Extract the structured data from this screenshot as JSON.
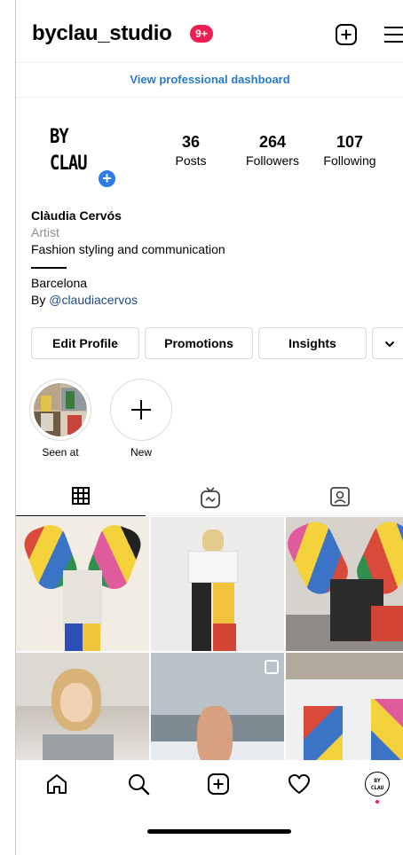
{
  "header": {
    "username": "byclau_studio",
    "notification_badge": "9+",
    "add_icon": "plus-square-icon",
    "menu_icon": "hamburger-menu-icon"
  },
  "pro_dashboard": {
    "label": "View professional dashboard"
  },
  "profile": {
    "avatar_text": {
      "line1": "BY",
      "line2": "CLAU"
    },
    "avatar_add_icon": "plus-circle-icon",
    "stats": {
      "posts": {
        "count": "36",
        "label": "Posts"
      },
      "followers": {
        "count": "264",
        "label": "Followers"
      },
      "following": {
        "count": "107",
        "label": "Following"
      }
    },
    "bio": {
      "name": "Clàudia Cervós",
      "category": "Artist",
      "line1": "Fashion styling and communication",
      "location": "Barcelona",
      "by_prefix": "By ",
      "mention": "@claudiacervos"
    }
  },
  "actions": {
    "edit_profile": "Edit Profile",
    "promotions": "Promotions",
    "insights": "Insights",
    "more_icon": "chevron-down-icon"
  },
  "highlights": [
    {
      "label": "Seen at"
    },
    {
      "label": "New"
    }
  ],
  "tabs": [
    {
      "icon": "grid-icon",
      "active": true
    },
    {
      "icon": "igtv-icon",
      "active": false
    },
    {
      "icon": "tagged-icon",
      "active": false
    }
  ],
  "bottom_nav": [
    {
      "icon": "home-icon"
    },
    {
      "icon": "search-icon"
    },
    {
      "icon": "new-post-icon"
    },
    {
      "icon": "heart-icon"
    },
    {
      "icon": "profile-avatar-icon",
      "label_line1": "BY",
      "label_line2": "CLAU"
    }
  ],
  "colors": {
    "accent_blue": "#2a79cf",
    "badge_red": "#ee1d52",
    "link_blue": "#1c4b8c",
    "plus_blue": "#2b7de9"
  }
}
